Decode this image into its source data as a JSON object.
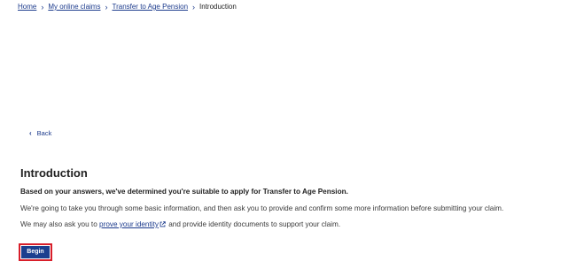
{
  "breadcrumb": {
    "items": [
      {
        "label": "Home"
      },
      {
        "label": "My online claims"
      },
      {
        "label": "Transfer to Age Pension"
      }
    ],
    "current": "Introduction",
    "separator": "›"
  },
  "back": {
    "label": "Back",
    "icon": "chevron-left-icon"
  },
  "main": {
    "title": "Introduction",
    "lead": "Based on your answers, we've determined you're suitable to apply for Transfer to Age Pension.",
    "para1": "We're going to take you through some basic information, and then ask you to provide and confirm some more information before submitting your claim.",
    "para2_prefix": "We may also ask you to ",
    "para2_link": "prove your identity",
    "para2_suffix": " and provide identity documents to support your claim.",
    "link_icon": "external-link-icon"
  },
  "actions": {
    "begin_label": "Begin"
  },
  "colors": {
    "link": "#1b3a8c",
    "button": "#1b3f8f",
    "focus_outline": "#d81e2a"
  }
}
